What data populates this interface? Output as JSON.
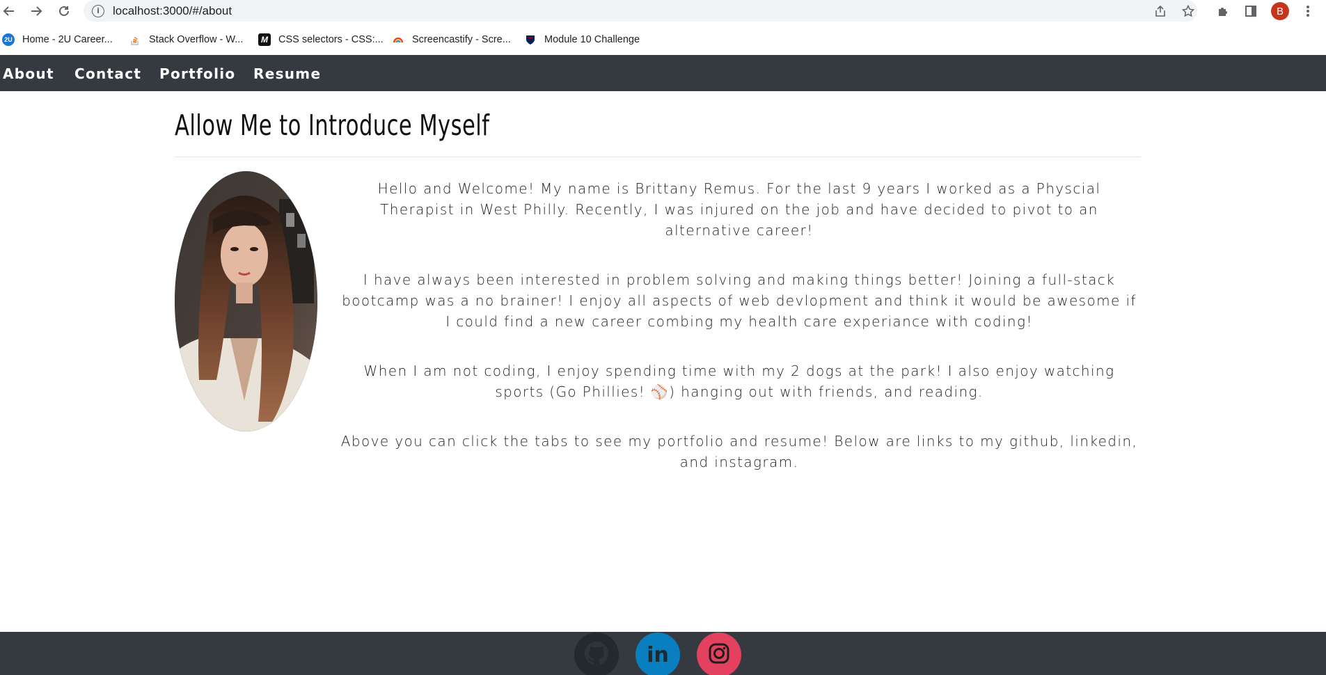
{
  "browser": {
    "url": "localhost:3000/#/about",
    "avatar_initial": "B",
    "bookmarks": [
      {
        "label": "Home - 2U Career...",
        "icon": "2u-icon"
      },
      {
        "label": "Stack Overflow - W...",
        "icon": "stackoverflow-icon"
      },
      {
        "label": "CSS selectors - CSS:...",
        "icon": "mdn-icon"
      },
      {
        "label": "Screencastify - Scre...",
        "icon": "screencastify-icon"
      },
      {
        "label": "Module 10 Challenge",
        "icon": "penn-icon"
      }
    ]
  },
  "nav": {
    "items": [
      {
        "label": "About"
      },
      {
        "label": "Contact"
      },
      {
        "label": "Portfolio"
      },
      {
        "label": "Resume"
      }
    ]
  },
  "about": {
    "title": "Allow Me to Introduce Myself",
    "paragraphs": [
      "Hello and Welcome! My name is Brittany Remus. For the last 9 years I worked as a Physcial Therapist in West Philly. Recently, I was injured on the job and have decided to pivot to an alternative career!",
      "I have always been interested in problem solving and making things better! Joining a full-stack bootcamp was a no brainer! I enjoy all aspects of web devlopment and think it would be awesome if I could find a new career combing my health care experiance with coding!",
      "When I am not coding, I enjoy spending time with my 2 dogs at the park! I also enjoy watching sports (Go Phillies! ⚾) hanging out with friends, and reading.",
      "Above you can click the tabs to see my portfolio and resume! Below are links to my github, linkedin, and instagram."
    ]
  },
  "footer": {
    "links": [
      {
        "name": "github",
        "icon": "github-icon",
        "color": "#24292e"
      },
      {
        "name": "linkedin",
        "icon": "linkedin-icon",
        "color": "#0a7fc0"
      },
      {
        "name": "instagram",
        "icon": "instagram-icon",
        "color": "#e4405f"
      }
    ]
  },
  "colors": {
    "navbar": "#343a40",
    "footer": "#343a40",
    "avatar": "#c5351c"
  }
}
